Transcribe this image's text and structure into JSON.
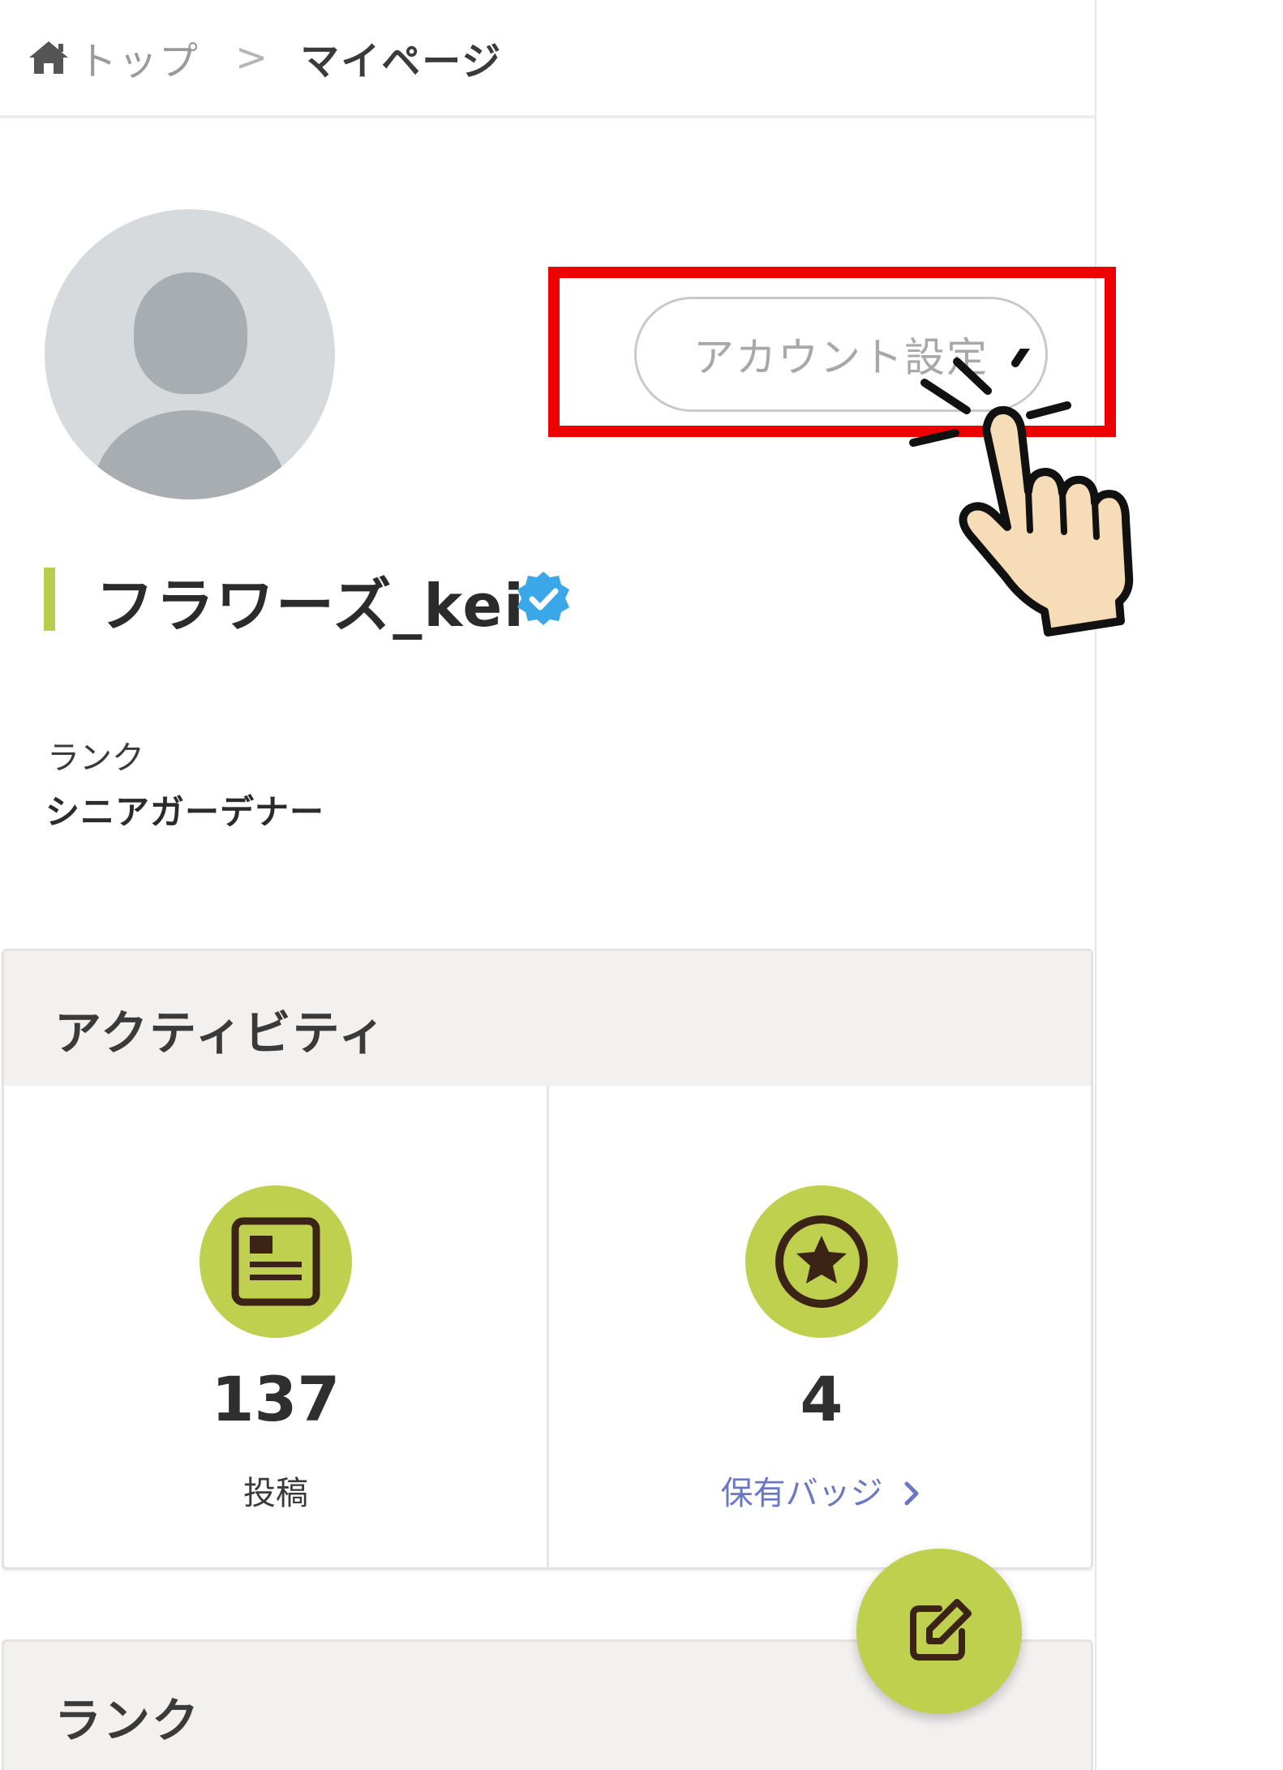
{
  "breadcrumb": {
    "home_icon": "home-icon",
    "top_label": "トップ",
    "separator": ">",
    "current_label": "マイページ"
  },
  "profile": {
    "avatar_icon": "default-avatar-icon",
    "account_settings_label": "アカウント設定",
    "username": "フラワーズ_kei",
    "verified_icon": "verified-badge-icon",
    "rank_label": "ランク",
    "rank_value": "シニアガーデナー"
  },
  "activity": {
    "title": "アクティビティ",
    "stats": [
      {
        "icon": "post-document-icon",
        "value": "137",
        "label": "投稿"
      },
      {
        "icon": "star-badge-icon",
        "value": "4",
        "label": "保有バッジ",
        "link_icon": "chevron-right-icon"
      }
    ]
  },
  "rank_section": {
    "title": "ランク"
  },
  "fab": {
    "icon": "edit-icon"
  },
  "annotation": {
    "highlight_color": "#ee0000",
    "pointer_icon": "hand-pointer-icon"
  },
  "colors": {
    "accent_green": "#bfcf4e",
    "link_blue": "#6a78c4",
    "verified_blue": "#3aa7e8"
  }
}
